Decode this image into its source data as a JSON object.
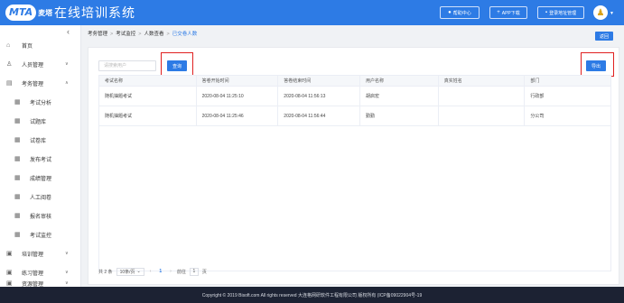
{
  "header": {
    "logo_badge": "MTA",
    "logo_text": "麦塔",
    "title": "在线培训系统",
    "buttons": [
      {
        "label": "帮助中心",
        "icon": "help-icon"
      },
      {
        "label": "APP下载",
        "icon": "download-icon"
      },
      {
        "label": "登录地址管理",
        "icon": "address-icon"
      }
    ]
  },
  "sidebar": {
    "items": [
      {
        "label": "首页",
        "icon": "home-icon",
        "caret": ""
      },
      {
        "label": "人员管理",
        "icon": "user-icon",
        "caret": "∨"
      },
      {
        "label": "考务管理",
        "icon": "exam-icon",
        "caret": "∧"
      },
      {
        "label": "考试分析",
        "icon": "analysis-icon",
        "caret": ""
      },
      {
        "label": "试题库",
        "icon": "question-bank-icon",
        "caret": ""
      },
      {
        "label": "试卷库",
        "icon": "paper-bank-icon",
        "caret": ""
      },
      {
        "label": "发布考试",
        "icon": "publish-icon",
        "caret": ""
      },
      {
        "label": "成绩管理",
        "icon": "score-icon",
        "caret": ""
      },
      {
        "label": "人工阅卷",
        "icon": "marking-icon",
        "caret": ""
      },
      {
        "label": "报名审核",
        "icon": "review-icon",
        "caret": ""
      },
      {
        "label": "考试监控",
        "icon": "monitor-icon",
        "caret": ""
      },
      {
        "label": "培训管理",
        "icon": "training-icon",
        "caret": "∨"
      },
      {
        "label": "练习管理",
        "icon": "practice-icon",
        "caret": "∨"
      },
      {
        "label": "资源管理",
        "icon": "resource-icon",
        "caret": "∨"
      }
    ]
  },
  "breadcrumb": [
    "考务管理",
    "考试监控",
    "人数查看",
    "已交卷人数"
  ],
  "buttons": {
    "back": "返回",
    "query": "查询",
    "export": "导出"
  },
  "search": {
    "placeholder": "请搜索用户"
  },
  "table": {
    "columns": [
      "考试名称",
      "答卷开始时间",
      "答卷结束时间",
      "用户名称",
      "真实姓名",
      "部门"
    ],
    "rows": [
      [
        "随机抽题考试",
        "2020-08-04 11:25:10",
        "2020-08-04 11:56:13",
        "胡启宏",
        "",
        "行政部"
      ],
      [
        "随机抽题考试",
        "2020-08-04 11:25:46",
        "2020-08-04 11:56:44",
        "勤勤",
        "",
        "分公司"
      ]
    ]
  },
  "pager": {
    "total": "共 2 条",
    "page_size": "10条/页",
    "current_page": "1",
    "goto_label": "前往",
    "goto_value": "1",
    "page_suffix": "页"
  },
  "footer": {
    "text": "Copyright © 2019 Bisoft.com All rights reserved 大连格网研软件工程有限公司 版权所有 (ICP备09022904号-19"
  }
}
